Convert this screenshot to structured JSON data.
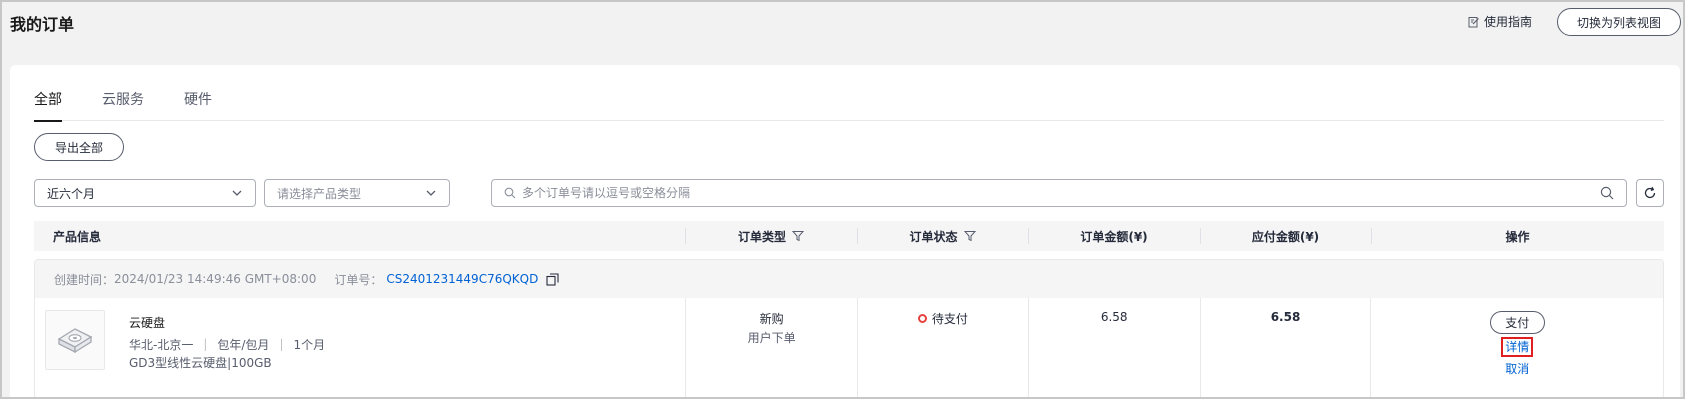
{
  "header": {
    "title": "我的订单",
    "guide_label": "使用指南",
    "switch_view_label": "切换为列表视图"
  },
  "tabs": [
    {
      "label": "全部",
      "active": true
    },
    {
      "label": "云服务",
      "active": false
    },
    {
      "label": "硬件",
      "active": false
    }
  ],
  "toolbar": {
    "export_label": "导出全部"
  },
  "filters": {
    "time_range": "近六个月",
    "product_type_placeholder": "请选择产品类型",
    "search_placeholder": "多个订单号请以逗号或空格分隔"
  },
  "table": {
    "columns": {
      "product": "产品信息",
      "order_type": "订单类型",
      "order_status": "订单状态",
      "order_amount": "订单金额(¥)",
      "payable_amount": "应付金额(¥)",
      "actions": "操作"
    }
  },
  "order": {
    "created_label": "创建时间：",
    "created_time": "2024/01/23 14:49:46 GMT+08:00",
    "order_no_label": "订单号：",
    "order_no": "CS2401231449C76QKQD",
    "product_name": "云硬盘",
    "region": "华北-北京一",
    "billing": "包年/包月",
    "duration": "1个月",
    "spec": "GD3型线性云硬盘|100GB",
    "type": "新购",
    "type_sub": "用户下单",
    "status": "待支付",
    "amount": "6.58",
    "payable": "6.58",
    "pay_label": "支付",
    "detail_label": "详情",
    "cancel_label": "取消"
  },
  "colors": {
    "link": "#0062d3",
    "status_pending": "#e6423d",
    "highlight_box": "#e02020"
  }
}
